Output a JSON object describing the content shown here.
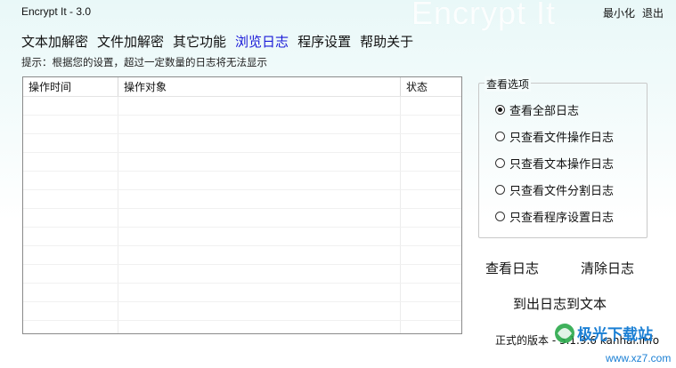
{
  "window": {
    "title": "Encrypt It - 3.0",
    "watermark": "Encrypt It",
    "minimize_label": "最小化",
    "exit_label": "退出"
  },
  "menu": {
    "items": [
      "文本加解密",
      "文件加解密",
      "其它功能",
      "浏览日志",
      "程序设置",
      "帮助关于"
    ],
    "active": "浏览日志"
  },
  "hint": "提示：根据您的设置，超过一定数量的日志将无法显示",
  "log_table": {
    "columns": [
      "操作时间",
      "操作对象",
      "状态"
    ],
    "rows": []
  },
  "view_options": {
    "title": "查看选项",
    "options": [
      "查看全部日志",
      "只查看文件操作日志",
      "只查看文本操作日志",
      "只查看文件分割日志",
      "只查看程序设置日志"
    ],
    "selected": "查看全部日志"
  },
  "actions": {
    "view_log": "查看日志",
    "clear_log": "清除日志",
    "export_log": "到出日志到文本"
  },
  "version": "正式的版本 - 3.1.9.6 kanhai.info",
  "badge": {
    "brand": "极光下载站",
    "url": "www.xz7.com",
    "accent": "#1a7fd4",
    "logo_color": "#2aa84a"
  }
}
